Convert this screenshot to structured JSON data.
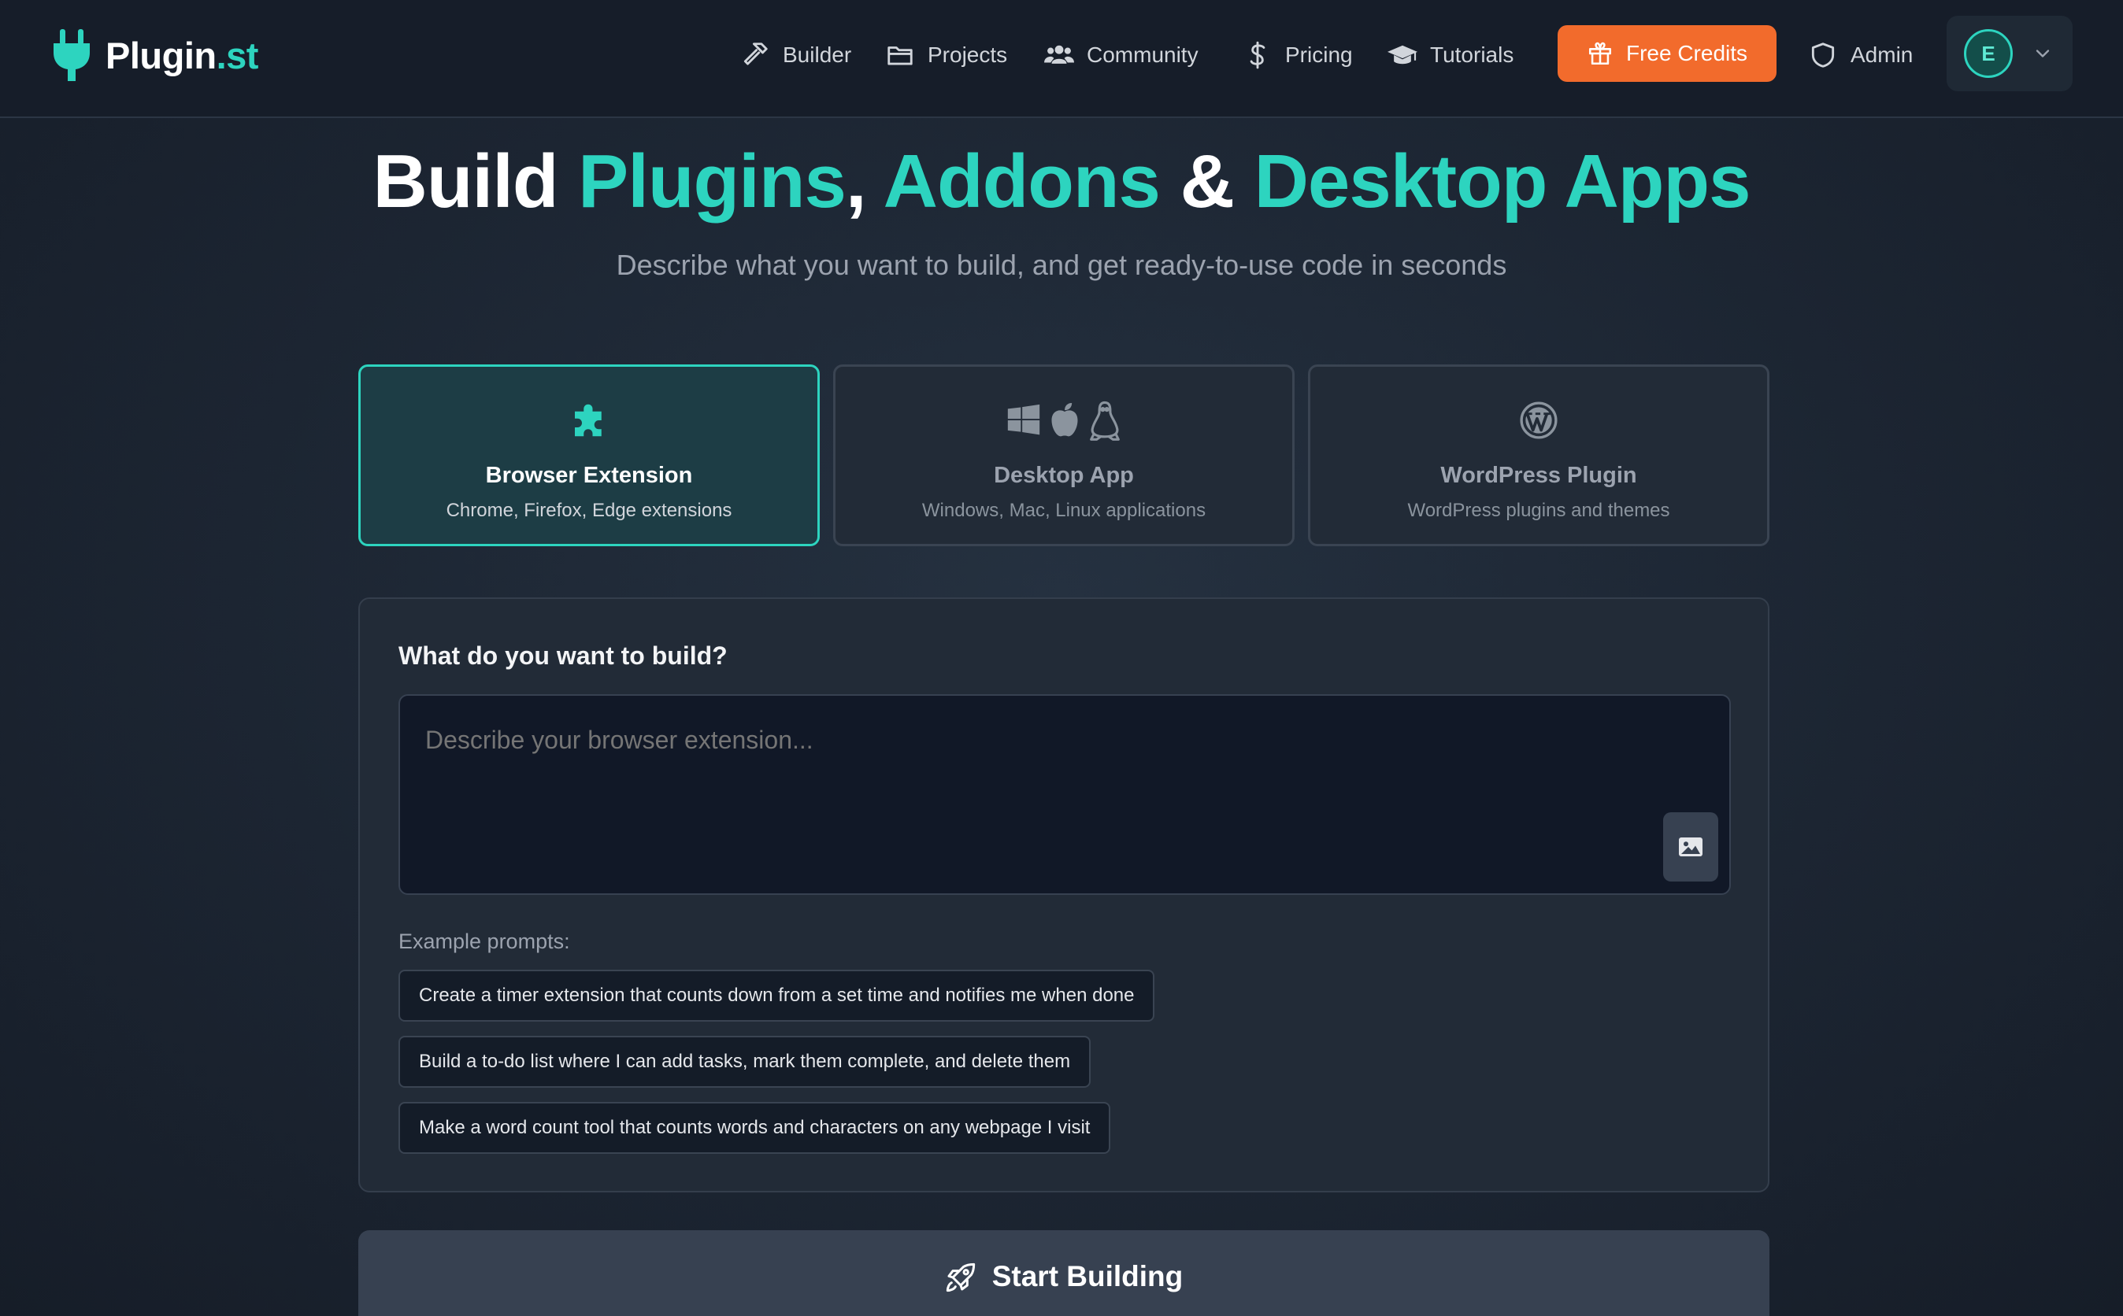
{
  "brand": {
    "name": "Plugin",
    "suffix": ".st"
  },
  "nav": {
    "builder": "Builder",
    "projects": "Projects",
    "community": "Community",
    "pricing": "Pricing",
    "tutorials": "Tutorials",
    "credits": "Free Credits",
    "admin": "Admin",
    "avatar_initial": "E"
  },
  "hero": {
    "title_build": "Build ",
    "title_plugins": "Plugins",
    "title_comma": ", ",
    "title_addons": "Addons",
    "title_amp": " & ",
    "title_desktop": "Desktop Apps",
    "subtitle": "Describe what you want to build, and get ready-to-use code in seconds"
  },
  "types": [
    {
      "title": "Browser Extension",
      "desc": "Chrome, Firefox, Edge extensions",
      "selected": true
    },
    {
      "title": "Desktop App",
      "desc": "Windows, Mac, Linux applications",
      "selected": false
    },
    {
      "title": "WordPress Plugin",
      "desc": "WordPress plugins and themes",
      "selected": false
    }
  ],
  "prompt": {
    "label": "What do you want to build?",
    "placeholder": "Describe your browser extension...",
    "value": ""
  },
  "examples": {
    "label": "Example prompts:",
    "items": [
      "Create a timer extension that counts down from a set time and notifies me when done",
      "Build a to-do list where I can add tasks, mark them complete, and delete them",
      "Make a word count tool that counts words and characters on any webpage I visit"
    ]
  },
  "start": {
    "label": "Start Building"
  },
  "colors": {
    "accent": "#2dd4bf",
    "cta": "#f26b2c",
    "nav_bg": "#161d29",
    "panel_bg": "#222b37"
  }
}
